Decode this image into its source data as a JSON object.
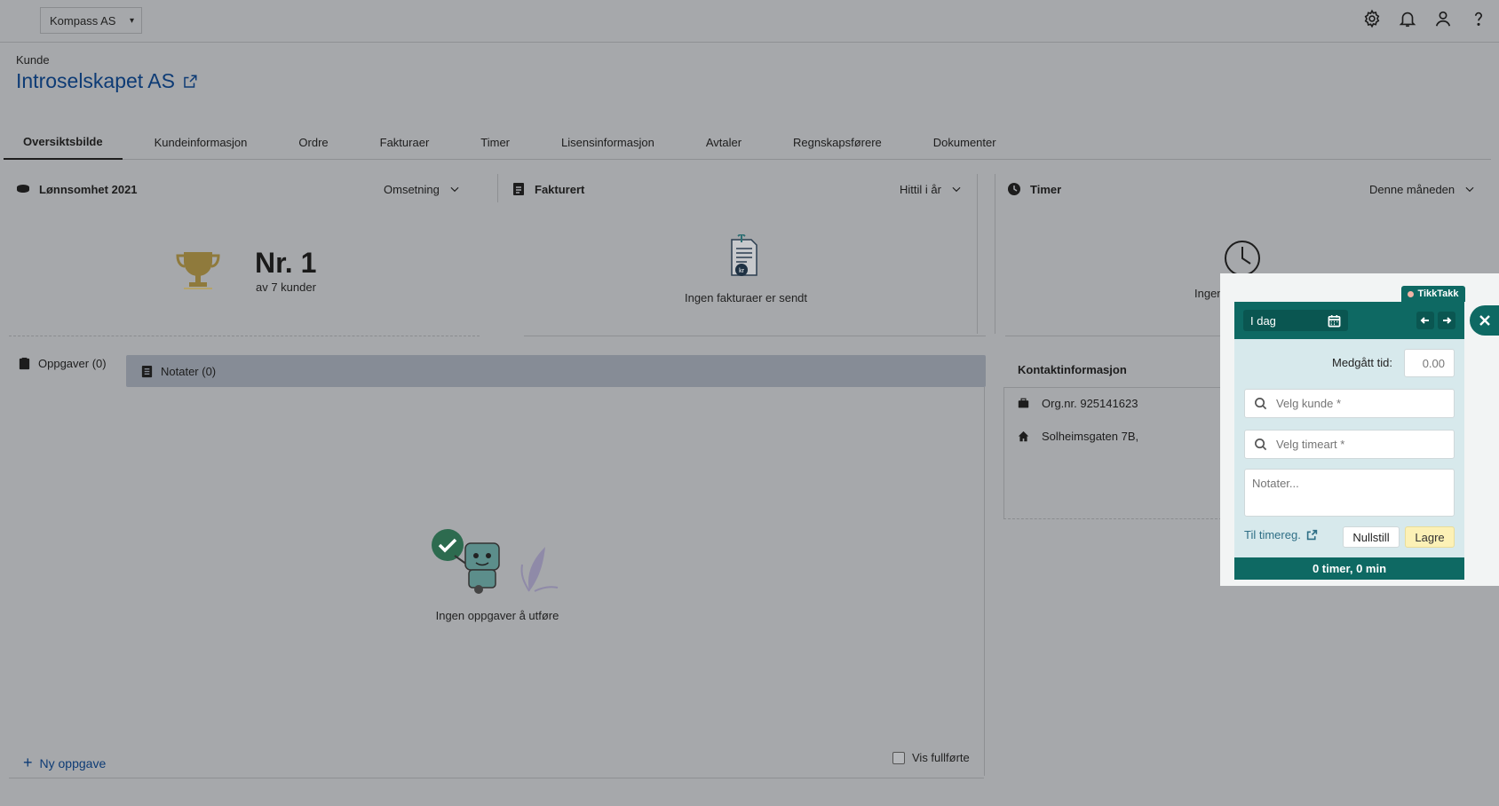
{
  "topbar": {
    "company": "Kompass AS",
    "icons": [
      "gear-icon",
      "bell-icon",
      "user-icon",
      "help-icon"
    ]
  },
  "header": {
    "breadcrumb": "Kunde",
    "title": "Introselskapet AS"
  },
  "tabs": [
    {
      "label": "Oversiktsbilde",
      "active": true
    },
    {
      "label": "Kundeinformasjon"
    },
    {
      "label": "Ordre"
    },
    {
      "label": "Fakturaer"
    },
    {
      "label": "Timer"
    },
    {
      "label": "Lisensinformasjon"
    },
    {
      "label": "Avtaler"
    },
    {
      "label": "Regnskapsførere"
    },
    {
      "label": "Dokumenter"
    }
  ],
  "profitability": {
    "title": "Lønnsomhet 2021",
    "dropdown": "Omsetning",
    "rank": "Nr. 1",
    "rank_sub": "av 7 kunder"
  },
  "invoiced": {
    "title": "Fakturert",
    "dropdown": "Hittil i år",
    "empty": "Ingen fakturaer er sendt"
  },
  "hours": {
    "title": "Timer",
    "dropdown": "Denne måneden",
    "empty": "Ingen timer er ført"
  },
  "tasks": {
    "tab_tasks": "Oppgaver (0)",
    "tab_notes": "Notater (0)",
    "empty": "Ingen oppgaver å utføre",
    "new_task": "Ny oppgave",
    "show_done": "Vis fullførte"
  },
  "contact": {
    "title": "Kontaktinformasjon",
    "org_nr": "Org.nr. 925141623",
    "address": "Solheimsgaten 7B,"
  },
  "tikktakk": {
    "badge": "TikkTakk",
    "date": "I dag",
    "time_label": "Medgått tid:",
    "time_value": "0.00",
    "customer_placeholder": "Velg kunde *",
    "activity_placeholder": "Velg timeart *",
    "notes_placeholder": "Notater...",
    "link": "Til timereg.",
    "reset": "Nullstill",
    "save": "Lagre",
    "total": "0 timer, 0 min"
  },
  "colors": {
    "accent_teal": "#0e6963",
    "link_blue": "#0d3b75",
    "save_yellow": "#fcf1b6"
  }
}
